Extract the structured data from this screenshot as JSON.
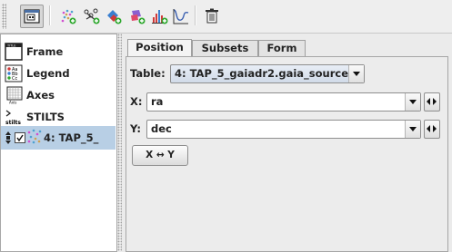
{
  "toolbar": {
    "buttons": [
      {
        "icon": "plot-window-icon",
        "pressed": true
      },
      {
        "icon": "add-scatter-layer-icon"
      },
      {
        "icon": "add-pair-layer-icon"
      },
      {
        "icon": "add-area-layer-icon"
      },
      {
        "icon": "add-area-layer-2-icon"
      },
      {
        "icon": "add-histogram-layer-icon"
      },
      {
        "icon": "add-function-layer-icon"
      },
      {
        "icon": "trash-icon"
      }
    ]
  },
  "control_list": {
    "items": [
      {
        "label": "Frame",
        "icon": "frame-icon"
      },
      {
        "label": "Legend",
        "icon": "legend-icon"
      },
      {
        "label": "Axes",
        "icon": "axes-icon"
      },
      {
        "label": "STILTS",
        "icon": "stilts-icon"
      }
    ],
    "layer": {
      "label": "4: TAP_5_",
      "checked": true
    }
  },
  "tabs": [
    "Position",
    "Subsets",
    "Form"
  ],
  "active_tab": "Position",
  "position": {
    "table_label": "Table:",
    "table_value": "4: TAP_5_gaiadr2.gaia_source",
    "x_label": "X:",
    "x_value": "ra",
    "y_label": "Y:",
    "y_value": "dec",
    "swap_label": "X ↔ Y"
  },
  "colors": {
    "selection": "#b8cfe5",
    "panel_bg": "#ebebeb"
  }
}
